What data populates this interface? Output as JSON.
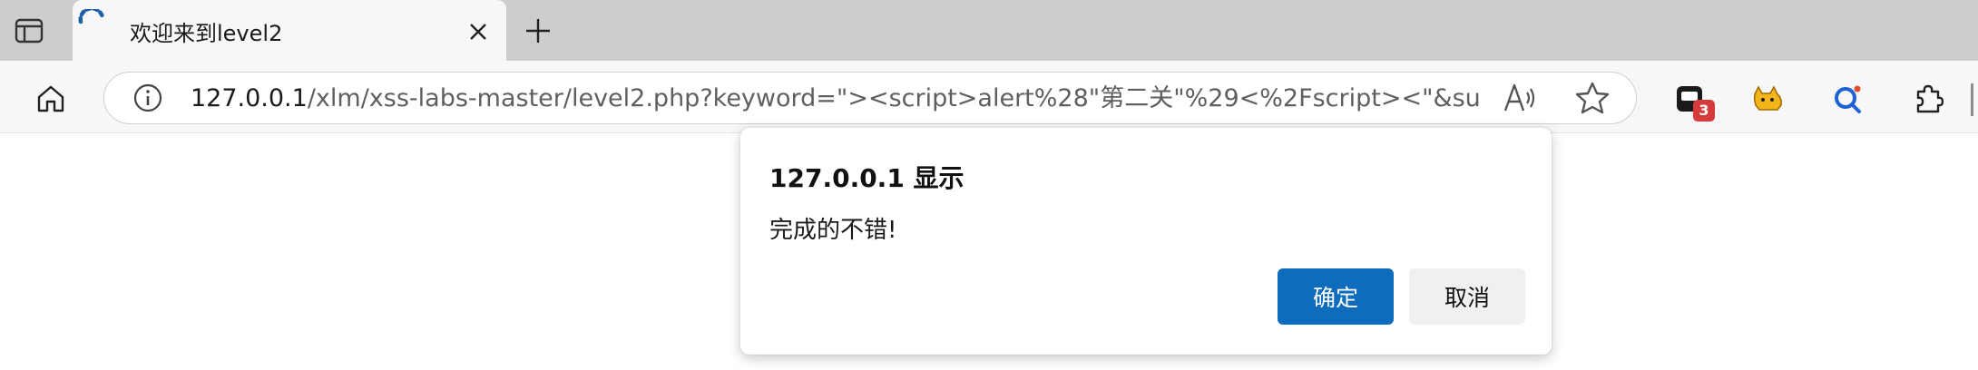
{
  "browser": {
    "tab": {
      "title": "欢迎来到level2",
      "favicon": "loading-spinner-icon"
    },
    "address_bar": {
      "url_host": "127.0.0.1",
      "url_path": "/xlm/xss-labs-master/level2.php?keyword=\"><script>alert%28\"第二关\"%29<%2Fscript><\"&submit=搜索"
    },
    "extensions": {
      "badge_count": "3"
    },
    "icons": {
      "tab_actions": "tab-actions-icon",
      "close": "close-icon",
      "new_tab": "plus-icon",
      "home": "home-icon",
      "info": "info-icon",
      "read_aloud": "read-aloud-icon",
      "favorite": "star-icon",
      "extensions": "puzzle-icon"
    }
  },
  "dialog": {
    "title": "127.0.0.1 显示",
    "message": "完成的不错!",
    "ok_label": "确定",
    "cancel_label": "取消"
  },
  "colors": {
    "tabstrip": "#cdcdcd",
    "toolbar": "#f7f7f7",
    "primary_button": "#0f6cbd",
    "badge": "#d63b3b"
  }
}
